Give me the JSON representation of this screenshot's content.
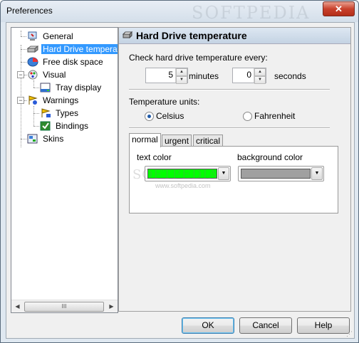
{
  "window": {
    "title": "Preferences",
    "close_glyph": "✕",
    "watermark": "SOFTPEDIA"
  },
  "tree": {
    "items": [
      {
        "label": "General",
        "icon": "general-settings-icon"
      },
      {
        "label": "Hard Drive temperature",
        "icon": "hard-drive-icon",
        "selected": true
      },
      {
        "label": "Free disk space",
        "icon": "disk-space-pie-icon"
      },
      {
        "label": "Visual",
        "icon": "visual-settings-icon"
      },
      {
        "label": "Tray display",
        "icon": "tray-display-icon"
      },
      {
        "label": "Warnings",
        "icon": "warnings-icon"
      },
      {
        "label": "Types",
        "icon": "warning-types-icon"
      },
      {
        "label": "Bindings",
        "icon": "bindings-icon"
      },
      {
        "label": "Skins",
        "icon": "skins-icon"
      }
    ],
    "expander_glyph": "−",
    "scroll_left": "◀",
    "scroll_right": "▶",
    "scroll_thumb": "III"
  },
  "panel": {
    "title": "Hard Drive temperature",
    "check_label": "Check hard drive temperature every:",
    "minutes_value": "5",
    "minutes_label": "minutes",
    "seconds_value": "0",
    "seconds_label": "seconds",
    "units_label": "Temperature units:",
    "celsius_label": "Celsius",
    "fahrenheit_label": "Fahrenheit",
    "selected_unit": "Celsius",
    "tabs": [
      "normal",
      "urgent",
      "critical"
    ],
    "active_tab": "normal",
    "text_color_label": "text color",
    "background_color_label": "background color",
    "text_color": "#00ff00",
    "background_color": "#a0a0a0",
    "tab_watermark": "SOFTPEDIA",
    "tab_watermark_url": "www.softpedia.com"
  },
  "buttons": {
    "ok": "OK",
    "cancel": "Cancel",
    "help": "Help"
  },
  "glyphs": {
    "spin_up": "▲",
    "spin_down": "▼",
    "combo_arrow": "▼",
    "grip": "⋰"
  },
  "colors": {
    "selection": "#3399ff",
    "text_color_swatch": "#00ff00",
    "background_color_swatch": "#a0a0a0"
  }
}
